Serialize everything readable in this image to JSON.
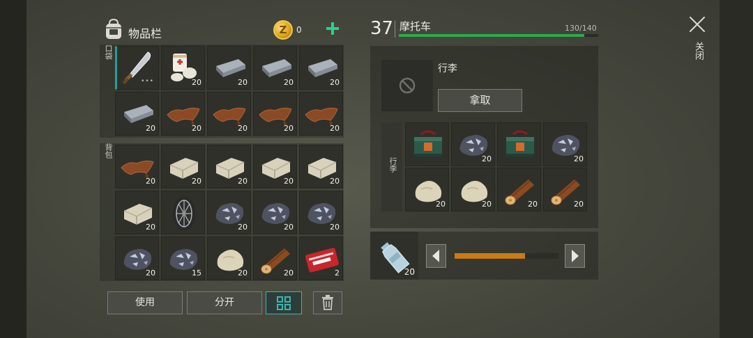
{
  "inventory": {
    "title": "物品栏",
    "coins": "0",
    "pocket_label": "口袋",
    "backpack_label": "背包",
    "pocket_slots": [
      {
        "icon": "machete-icon",
        "qty": "",
        "dots": "•••"
      },
      {
        "icon": "bandage-icon",
        "qty": "20"
      },
      {
        "icon": "iron-ingot-icon",
        "qty": "20"
      },
      {
        "icon": "iron-ingot-icon",
        "qty": "20"
      },
      {
        "icon": "iron-ingot-icon",
        "qty": "20"
      },
      {
        "icon": "iron-ingot-icon",
        "qty": "20"
      },
      {
        "icon": "leather-icon",
        "qty": "20"
      },
      {
        "icon": "leather-icon",
        "qty": "20"
      },
      {
        "icon": "leather-icon",
        "qty": "20"
      },
      {
        "icon": "leather-icon",
        "qty": "20"
      }
    ],
    "backpack_slots": [
      {
        "icon": "leather-icon",
        "qty": "20"
      },
      {
        "icon": "limestone-icon",
        "qty": "20"
      },
      {
        "icon": "limestone-icon",
        "qty": "20"
      },
      {
        "icon": "limestone-icon",
        "qty": "20"
      },
      {
        "icon": "limestone-icon",
        "qty": "20"
      },
      {
        "icon": "limestone-icon",
        "qty": "20"
      },
      {
        "icon": "wheel-icon",
        "qty": ""
      },
      {
        "icon": "iron-ore-icon",
        "qty": "20"
      },
      {
        "icon": "iron-ore-icon",
        "qty": "20"
      },
      {
        "icon": "iron-ore-icon",
        "qty": "20"
      },
      {
        "icon": "iron-ore-icon",
        "qty": "20"
      },
      {
        "icon": "iron-ore-icon",
        "qty": "15"
      },
      {
        "icon": "stone-icon",
        "qty": "20"
      },
      {
        "icon": "log-icon",
        "qty": "20"
      },
      {
        "icon": "coupon-icon",
        "qty": "2"
      }
    ]
  },
  "buttons": {
    "use": "使用",
    "split": "分开"
  },
  "vehicle": {
    "level": "37",
    "name": "摩托车",
    "capacity": "130/140",
    "capacity_fraction": 0.93
  },
  "luggage": {
    "title": "行李",
    "take": "拿取",
    "side_label": "行李",
    "slots": [
      {
        "icon": "supply-bag-icon",
        "qty": ""
      },
      {
        "icon": "iron-ore-icon",
        "qty": "20"
      },
      {
        "icon": "supply-bag-icon",
        "qty": ""
      },
      {
        "icon": "iron-ore-icon",
        "qty": "20"
      },
      {
        "icon": "stone-icon",
        "qty": "20"
      },
      {
        "icon": "stone-icon",
        "qty": "20"
      },
      {
        "icon": "log-icon",
        "qty": "20"
      },
      {
        "icon": "log-icon",
        "qty": "20"
      }
    ]
  },
  "fuel": {
    "icon": "bottle-icon",
    "qty": "20",
    "level_fraction": 0.68
  },
  "close_label": "关闭",
  "colors": {
    "accent_teal": "#3bb5ae",
    "capacity_green": "#2fa84f",
    "fuel_orange": "#cc7a12",
    "plus_green": "#2bd28a"
  }
}
